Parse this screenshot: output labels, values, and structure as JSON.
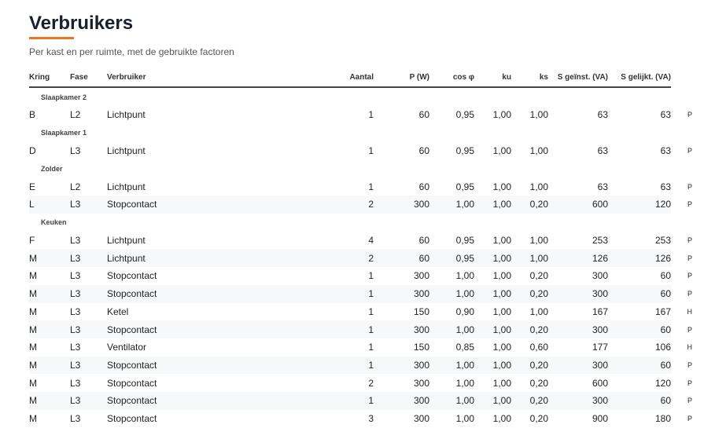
{
  "page": {
    "title": "Verbruikers",
    "subtitle": "Per kast en per ruimte, met de gebruikte factoren"
  },
  "accent_color": "#e87722",
  "table": {
    "headers": {
      "kring": "Kring",
      "fase": "Fase",
      "verbruiker": "Verbruiker",
      "aantal": "Aantal",
      "p": "P (W)",
      "cos": "cos φ",
      "ku": "ku",
      "ks": "ks",
      "s_geinst": "S geïnst. (VA)",
      "s_gelijkt": "S gelijkt. (VA)"
    },
    "groups": [
      {
        "name": "Slaapkamer 2",
        "rows": [
          {
            "kring": "B",
            "fase": "L2",
            "verbruiker": "Lichtpunt",
            "aantal": "1",
            "p": "60",
            "cos": "0,95",
            "ku": "1,00",
            "ks": "1,00",
            "s_geinst": "63",
            "s_gelijkt": "63",
            "flag": "P"
          }
        ]
      },
      {
        "name": "Slaapkamer 1",
        "rows": [
          {
            "kring": "D",
            "fase": "L3",
            "verbruiker": "Lichtpunt",
            "aantal": "1",
            "p": "60",
            "cos": "0,95",
            "ku": "1,00",
            "ks": "1,00",
            "s_geinst": "63",
            "s_gelijkt": "63",
            "flag": "P"
          }
        ]
      },
      {
        "name": "Zolder",
        "rows": [
          {
            "kring": "E",
            "fase": "L2",
            "verbruiker": "Lichtpunt",
            "aantal": "1",
            "p": "60",
            "cos": "0,95",
            "ku": "1,00",
            "ks": "1,00",
            "s_geinst": "63",
            "s_gelijkt": "63",
            "flag": "P"
          },
          {
            "kring": "L",
            "fase": "L3",
            "verbruiker": "Stopcontact",
            "aantal": "2",
            "p": "300",
            "cos": "1,00",
            "ku": "1,00",
            "ks": "0,20",
            "s_geinst": "600",
            "s_gelijkt": "120",
            "flag": "P"
          }
        ]
      },
      {
        "name": "Keuken",
        "rows": [
          {
            "kring": "F",
            "fase": "L3",
            "verbruiker": "Lichtpunt",
            "aantal": "4",
            "p": "60",
            "cos": "0,95",
            "ku": "1,00",
            "ks": "1,00",
            "s_geinst": "253",
            "s_gelijkt": "253",
            "flag": "P"
          },
          {
            "kring": "M",
            "fase": "L3",
            "verbruiker": "Lichtpunt",
            "aantal": "2",
            "p": "60",
            "cos": "0,95",
            "ku": "1,00",
            "ks": "1,00",
            "s_geinst": "126",
            "s_gelijkt": "126",
            "flag": "P"
          },
          {
            "kring": "M",
            "fase": "L3",
            "verbruiker": "Stopcontact",
            "aantal": "1",
            "p": "300",
            "cos": "1,00",
            "ku": "1,00",
            "ks": "0,20",
            "s_geinst": "300",
            "s_gelijkt": "60",
            "flag": "P"
          },
          {
            "kring": "M",
            "fase": "L3",
            "verbruiker": "Stopcontact",
            "aantal": "1",
            "p": "300",
            "cos": "1,00",
            "ku": "1,00",
            "ks": "0,20",
            "s_geinst": "300",
            "s_gelijkt": "60",
            "flag": "P"
          },
          {
            "kring": "M",
            "fase": "L3",
            "verbruiker": "Ketel",
            "aantal": "1",
            "p": "150",
            "cos": "0,90",
            "ku": "1,00",
            "ks": "1,00",
            "s_geinst": "167",
            "s_gelijkt": "167",
            "flag": "H"
          },
          {
            "kring": "M",
            "fase": "L3",
            "verbruiker": "Stopcontact",
            "aantal": "1",
            "p": "300",
            "cos": "1,00",
            "ku": "1,00",
            "ks": "0,20",
            "s_geinst": "300",
            "s_gelijkt": "60",
            "flag": "P"
          },
          {
            "kring": "M",
            "fase": "L3",
            "verbruiker": "Ventilator",
            "aantal": "1",
            "p": "150",
            "cos": "0,85",
            "ku": "1,00",
            "ks": "0,60",
            "s_geinst": "177",
            "s_gelijkt": "106",
            "flag": "H"
          },
          {
            "kring": "M",
            "fase": "L3",
            "verbruiker": "Stopcontact",
            "aantal": "1",
            "p": "300",
            "cos": "1,00",
            "ku": "1,00",
            "ks": "0,20",
            "s_geinst": "300",
            "s_gelijkt": "60",
            "flag": "P"
          },
          {
            "kring": "M",
            "fase": "L3",
            "verbruiker": "Stopcontact",
            "aantal": "2",
            "p": "300",
            "cos": "1,00",
            "ku": "1,00",
            "ks": "0,20",
            "s_geinst": "600",
            "s_gelijkt": "120",
            "flag": "P"
          },
          {
            "kring": "M",
            "fase": "L3",
            "verbruiker": "Stopcontact",
            "aantal": "1",
            "p": "300",
            "cos": "1,00",
            "ku": "1,00",
            "ks": "0,20",
            "s_geinst": "300",
            "s_gelijkt": "60",
            "flag": "P"
          },
          {
            "kring": "M",
            "fase": "L3",
            "verbruiker": "Stopcontact",
            "aantal": "3",
            "p": "300",
            "cos": "1,00",
            "ku": "1,00",
            "ks": "0,20",
            "s_geinst": "900",
            "s_gelijkt": "180",
            "flag": "P"
          }
        ]
      }
    ]
  }
}
